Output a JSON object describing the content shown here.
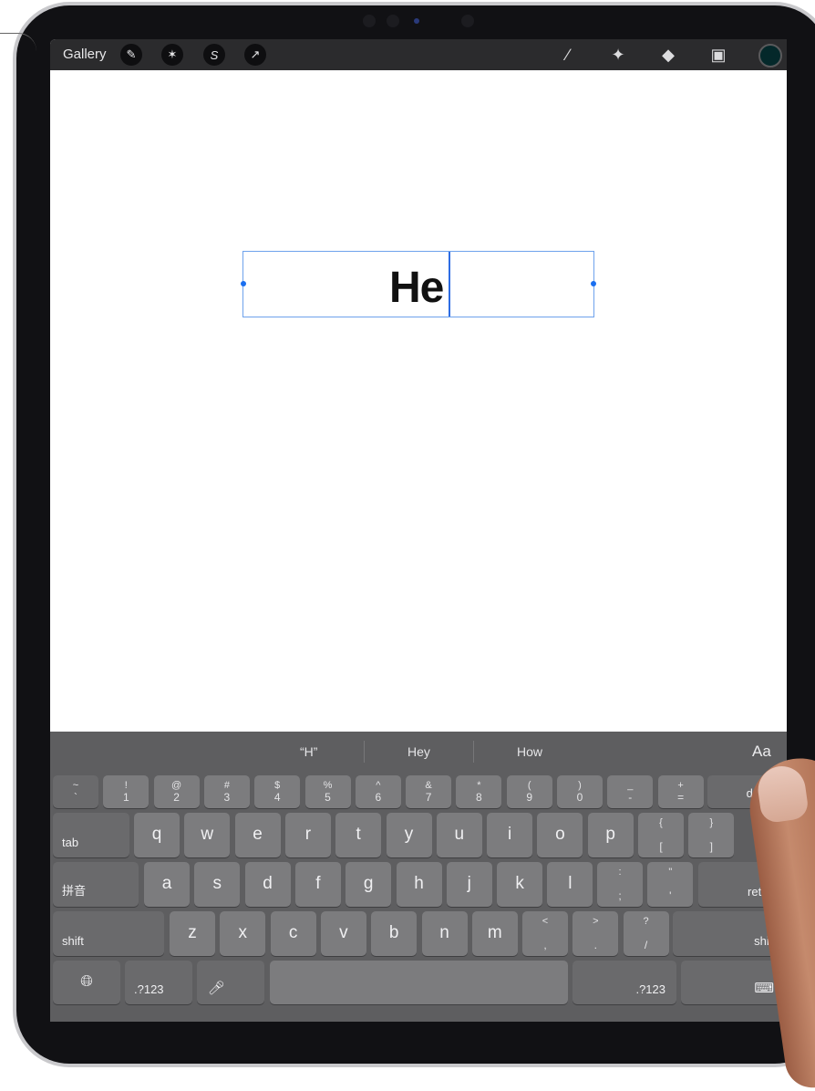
{
  "toolbar": {
    "gallery_label": "Gallery",
    "left_buttons": [
      {
        "name": "actions-wrench-icon",
        "glyph": "✎"
      },
      {
        "name": "adjustments-wand-icon",
        "glyph": "✶"
      },
      {
        "name": "selection-icon",
        "glyph": "S"
      },
      {
        "name": "transform-arrow-icon",
        "glyph": "↗"
      }
    ],
    "right_tools": [
      {
        "name": "brush-icon",
        "glyph": "∕"
      },
      {
        "name": "smudge-icon",
        "glyph": "✦"
      },
      {
        "name": "eraser-icon",
        "glyph": "◆"
      },
      {
        "name": "layers-icon",
        "glyph": "▣"
      }
    ],
    "active_color": "#04282a"
  },
  "canvas": {
    "text_value": "He"
  },
  "keyboard": {
    "suggestions": [
      "“H”",
      "Hey",
      "How"
    ],
    "format_label": "Aa",
    "number_row": [
      {
        "top": "~",
        "bottom": "`"
      },
      {
        "top": "!",
        "bottom": "1"
      },
      {
        "top": "@",
        "bottom": "2"
      },
      {
        "top": "#",
        "bottom": "3"
      },
      {
        "top": "$",
        "bottom": "4"
      },
      {
        "top": "%",
        "bottom": "5"
      },
      {
        "top": "^",
        "bottom": "6"
      },
      {
        "top": "&",
        "bottom": "7"
      },
      {
        "top": "*",
        "bottom": "8"
      },
      {
        "top": "(",
        "bottom": "9"
      },
      {
        "top": ")",
        "bottom": "0"
      },
      {
        "top": "_",
        "bottom": "-"
      },
      {
        "top": "+",
        "bottom": "="
      }
    ],
    "delete_label": "delete",
    "tab_label": "tab",
    "row_q": [
      "q",
      "w",
      "e",
      "r",
      "t",
      "y",
      "u",
      "i",
      "o",
      "p"
    ],
    "row_q_extra": [
      {
        "top": "{",
        "bottom": "["
      },
      {
        "top": "}",
        "bottom": "]"
      }
    ],
    "pinyin_label": "拼音",
    "row_a": [
      "a",
      "s",
      "d",
      "f",
      "g",
      "h",
      "j",
      "k",
      "l"
    ],
    "row_a_extra": [
      {
        "top": ":",
        "bottom": ";"
      },
      {
        "top": "\"",
        "bottom": "'"
      }
    ],
    "return_label": "return",
    "shift_label": "shift",
    "row_z": [
      "z",
      "x",
      "c",
      "v",
      "b",
      "n",
      "m"
    ],
    "row_z_extra": [
      {
        "top": "<",
        "bottom": ","
      },
      {
        "top": ">",
        "bottom": "."
      },
      {
        "top": "?",
        "bottom": "/"
      }
    ],
    "globe_icon": "globe-icon",
    "numbers_label": ".?123",
    "mic_icon": "microphone-icon",
    "hide_keyboard_icon": "keyboard-dismiss-icon"
  }
}
